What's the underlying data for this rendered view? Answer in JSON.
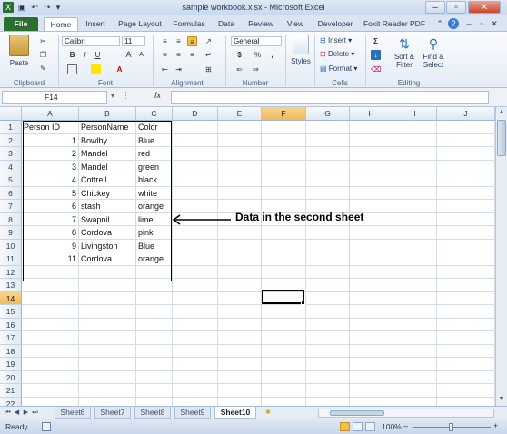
{
  "window": {
    "title": "sample workbook.xlsx - Microsoft Excel",
    "quick_access": {
      "save": "▣",
      "undo": "↶",
      "redo": "↷",
      "custom": "▾"
    },
    "controls": {
      "minimize": "–",
      "restore": "▫",
      "close": "✕"
    }
  },
  "tabs": [
    "File",
    "Home",
    "Insert",
    "Page Layout",
    "Formulas",
    "Data",
    "Review",
    "View",
    "Developer",
    "Foxit Reader PDF"
  ],
  "active_tab": "Home",
  "ribbon": {
    "clipboard": {
      "paste": "Paste",
      "label": "Clipboard"
    },
    "font": {
      "name": "Calibri",
      "size": "11",
      "label": "Font",
      "bold": "B",
      "italic": "I",
      "underline": "U",
      "grow": "A",
      "shrink": "A"
    },
    "alignment": {
      "label": "Alignment"
    },
    "number": {
      "format": "General",
      "currency": "$",
      "percent": "%",
      "comma": ",",
      "label": "Number"
    },
    "styles": {
      "label": "Styles"
    },
    "cells": {
      "insert": "Insert",
      "delete": "Delete",
      "format": "Format",
      "label": "Cells"
    },
    "editing": {
      "sum": "Σ",
      "sort": "Sort &",
      "filter": "Filter",
      "find": "Find &",
      "select": "Select",
      "label": "Editing"
    }
  },
  "formula_bar": {
    "name_box": "F14",
    "fx": "fx",
    "value": ""
  },
  "columns": [
    "A",
    "B",
    "C",
    "D",
    "E",
    "F",
    "G",
    "H",
    "I",
    "J"
  ],
  "selected_column": "F",
  "rows": [
    "1",
    "2",
    "3",
    "4",
    "5",
    "6",
    "7",
    "8",
    "9",
    "10",
    "11",
    "12",
    "13",
    "14",
    "15",
    "16",
    "17",
    "18",
    "19",
    "20",
    "21",
    "22"
  ],
  "selected_row": "14",
  "table": {
    "headers": [
      "Person ID",
      "PersonName",
      "Color"
    ],
    "records": [
      {
        "id": "1",
        "name": "Bowlby",
        "color": "Blue"
      },
      {
        "id": "2",
        "name": "Mandel",
        "color": "red"
      },
      {
        "id": "3",
        "name": "Mandel",
        "color": "green"
      },
      {
        "id": "4",
        "name": "Cottrell",
        "color": "black"
      },
      {
        "id": "5",
        "name": "Chickey",
        "color": "white"
      },
      {
        "id": "6",
        "name": "stash",
        "color": "orange"
      },
      {
        "id": "7",
        "name": "Swapnil",
        "color": "lime"
      },
      {
        "id": "8",
        "name": "Cordova",
        "color": "pink"
      },
      {
        "id": "9",
        "name": "Livingston",
        "color": "Blue"
      },
      {
        "id": "11",
        "name": "Cordova",
        "color": "orange"
      }
    ]
  },
  "annotation": "Data in the second sheet",
  "sheets": [
    "Sheet6",
    "Sheet7",
    "Sheet8",
    "Sheet9",
    "Sheet10"
  ],
  "active_sheet": "Sheet10",
  "status": {
    "mode": "Ready",
    "zoom": "100%",
    "zoom_out": "–",
    "zoom_in": "+"
  }
}
